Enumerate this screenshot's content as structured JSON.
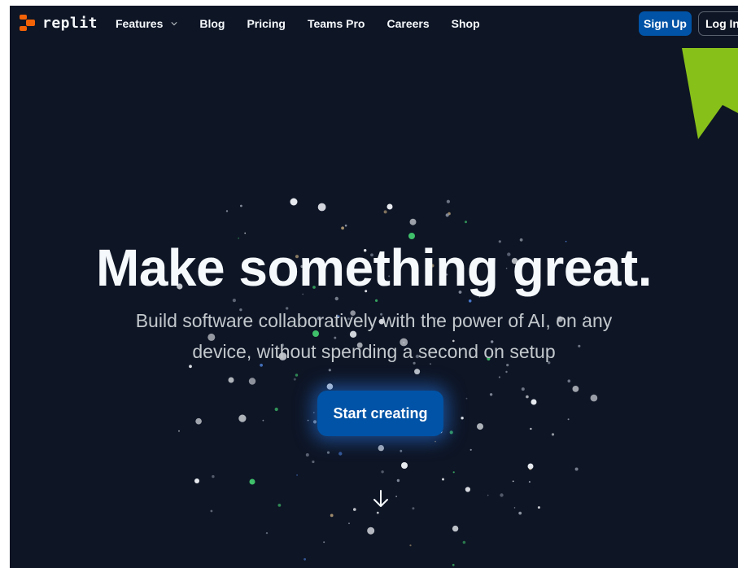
{
  "brand": {
    "name": "replit",
    "accent": "#f26207"
  },
  "nav": {
    "links": [
      {
        "label": "Features",
        "has_dropdown": true
      },
      {
        "label": "Blog"
      },
      {
        "label": "Pricing"
      },
      {
        "label": "Teams Pro"
      },
      {
        "label": "Careers"
      },
      {
        "label": "Shop"
      }
    ],
    "signup_label": "Sign Up",
    "login_label": "Log In"
  },
  "hero": {
    "title": "Make something great.",
    "subtitle_line1": "Build software collaboratively with the power of AI, on any",
    "subtitle_line2": "device, without spending a second on setup",
    "cta_label": "Start creating"
  },
  "colors": {
    "background": "#0e1525",
    "primary_button": "#0053a6",
    "annotation_arrow": "#88c01a",
    "particle_green": "#3fbf6a",
    "particle_tan": "#b7a078",
    "particle_blue": "#4a7bd1"
  },
  "icons": {
    "dropdown": "chevron-down-icon",
    "scroll": "arrow-down-icon"
  }
}
